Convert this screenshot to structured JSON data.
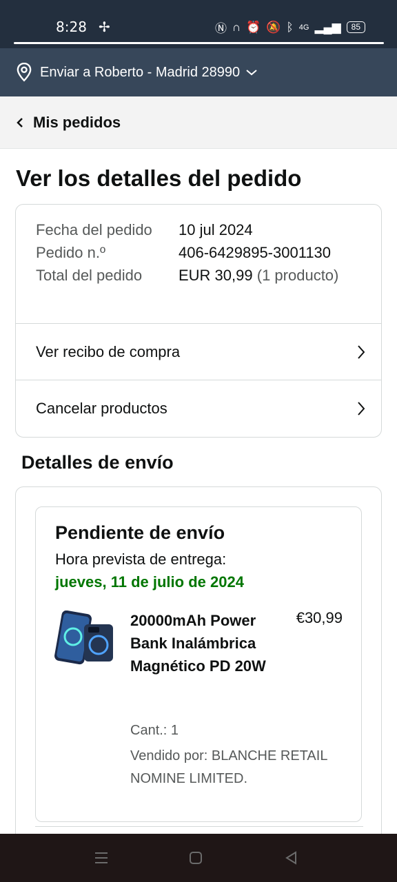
{
  "status_bar": {
    "time": "8:28",
    "battery": "85",
    "network": "4G",
    "icons": [
      "fan-icon",
      "nfc-icon",
      "headphones-icon",
      "alarm-icon",
      "mute-icon",
      "bluetooth-icon",
      "signal-icon",
      "battery-icon"
    ]
  },
  "deliver": {
    "text": "Enviar a Roberto - Madrid 28990",
    "icon": "location-pin-icon"
  },
  "breadcrumb": {
    "back_label": "Mis pedidos"
  },
  "page": {
    "title": "Ver los detalles del pedido"
  },
  "order_summary": {
    "date_label": "Fecha del pedido",
    "date_value": "10 jul 2024",
    "number_label": "Pedido n.º",
    "number_value": "406-6429895-3001130",
    "total_label": "Total del pedido",
    "total_value": "EUR 30,99",
    "total_items": "(1 producto)"
  },
  "links": {
    "receipt": "Ver recibo de compra",
    "cancel": "Cancelar productos"
  },
  "shipping": {
    "section_title": "Detalles de envío",
    "status": "Pendiente de envío",
    "eta_label": "Hora prevista de entrega:",
    "eta_date": "jueves, 11 de julio de 2024"
  },
  "product": {
    "title": "20000mAh Power Bank Inalámbrica Magnético PD 20W",
    "price": "€30,99",
    "quantity": "Cant.: 1",
    "seller": "Vendido por: BLANCHE RETAIL NOMINE LIMITED."
  },
  "colors": {
    "header_dark": "#232f3e",
    "deliver_bar": "#37475a",
    "eta_green": "#007600",
    "muted_text": "#565959"
  }
}
